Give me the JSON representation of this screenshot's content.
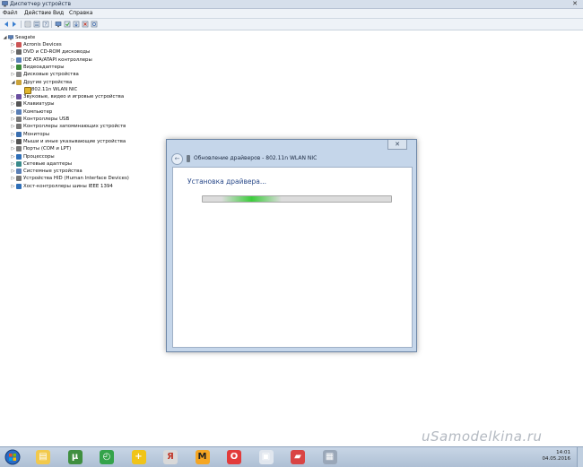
{
  "window": {
    "title": "Диспетчер устройств"
  },
  "menu": [
    "Файл",
    "Действие",
    "Вид",
    "Справка"
  ],
  "tree": {
    "root": "Seagate",
    "nodes": [
      {
        "label": "Acronis Devices",
        "level": 1
      },
      {
        "label": "DVD и CD-ROM дисководы",
        "level": 1
      },
      {
        "label": "IDE ATA/ATAPI контроллеры",
        "level": 1
      },
      {
        "label": "Видеоадаптеры",
        "level": 1
      },
      {
        "label": "Дисковые устройства",
        "level": 1
      },
      {
        "label": "Другие устройства",
        "level": 1
      },
      {
        "label": "802.11n WLAN NIC",
        "level": 2
      },
      {
        "label": "Звуковые, видео и игровые устройства",
        "level": 1
      },
      {
        "label": "Клавиатуры",
        "level": 1
      },
      {
        "label": "Компьютер",
        "level": 1
      },
      {
        "label": "Контроллеры USB",
        "level": 1
      },
      {
        "label": "Контроллеры запоминающих устройств",
        "level": 1
      },
      {
        "label": "Мониторы",
        "level": 1
      },
      {
        "label": "Мыши и иные указывающие устройства",
        "level": 1
      },
      {
        "label": "Порты (COM и LPT)",
        "level": 1
      },
      {
        "label": "Процессоры",
        "level": 1
      },
      {
        "label": "Сетевые адаптеры",
        "level": 1
      },
      {
        "label": "Системные устройства",
        "level": 1
      },
      {
        "label": "Устройства HID (Human Interface Devices)",
        "level": 1
      },
      {
        "label": "Хост-контроллеры шины IEEE 1394",
        "level": 1
      }
    ]
  },
  "dialog": {
    "title": "Обновление драйверов - 802.11n WLAN NIC",
    "status": "Установка драйвера...",
    "progress_fraction": 0.2
  },
  "taskbar": {
    "time": "14:01",
    "date": "04.05.2016",
    "apps": [
      "explorer",
      "utorrent",
      "stopwatch",
      "plus",
      "yandex",
      "m-app",
      "opera",
      "windows-explorer",
      "image-app",
      "device-manager"
    ]
  },
  "watermark": "uSamodelkina.ru",
  "colors": {
    "accent": "#2a4a8a",
    "progress": "#3ccd3c"
  }
}
